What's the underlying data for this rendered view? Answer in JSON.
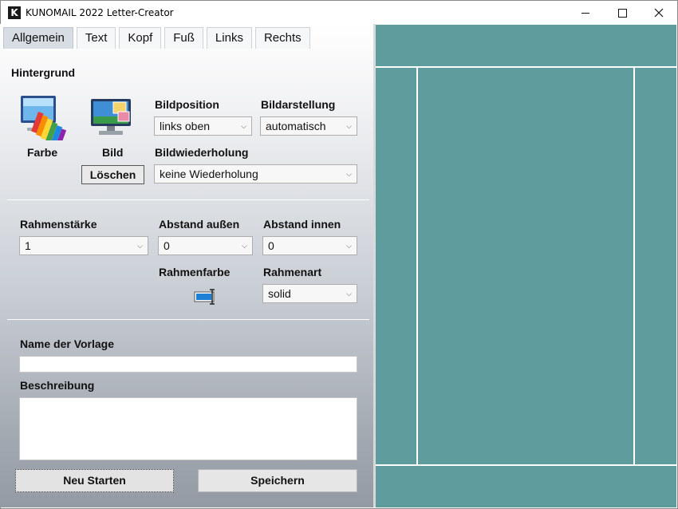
{
  "window": {
    "title": "KUNOMAIL 2022 Letter-Creator",
    "app_icon_letter": "K"
  },
  "tabs": [
    {
      "label": "Allgemein",
      "active": true
    },
    {
      "label": "Text"
    },
    {
      "label": "Kopf"
    },
    {
      "label": "Fuß"
    },
    {
      "label": "Links"
    },
    {
      "label": "Rechts"
    }
  ],
  "background": {
    "heading": "Hintergrund",
    "farbe_label": "Farbe",
    "bild_label": "Bild",
    "loeschen_label": "Löschen",
    "bildposition_label": "Bildposition",
    "bildposition_value": "links oben",
    "bilddarstellung_label": "Bildarstellung",
    "bilddarstellung_value": "automatisch",
    "bildwiederholung_label": "Bildwiederholung",
    "bildwiederholung_value": "keine Wiederholung"
  },
  "border": {
    "rahmenstaerke_label": "Rahmenstärke",
    "rahmenstaerke_value": "1",
    "abstand_aussen_label": "Abstand außen",
    "abstand_aussen_value": "0",
    "abstand_innen_label": "Abstand innen",
    "abstand_innen_value": "0",
    "rahmenfarbe_label": "Rahmenfarbe",
    "rahmenfarbe_color": "#1e7fd6",
    "rahmenart_label": "Rahmenart",
    "rahmenart_value": "solid"
  },
  "template": {
    "name_label": "Name der Vorlage",
    "name_value": "",
    "beschreibung_label": "Beschreibung",
    "beschreibung_value": ""
  },
  "actions": {
    "neu_starten_label": "Neu Starten",
    "speichern_label": "Speichern"
  },
  "preview": {
    "background_color": "#5f9c9e",
    "line_color": "#ffffff"
  }
}
